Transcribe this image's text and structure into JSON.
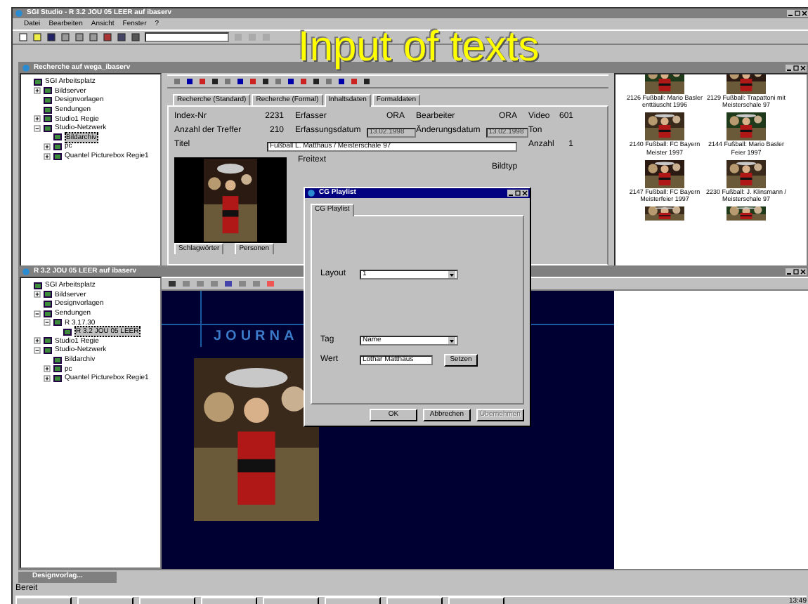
{
  "slide_title": "Input of texts",
  "app": {
    "title": "SGI Studio - R 3.2 JOU 05 LEER auf ibaserv",
    "menu": [
      "Datei",
      "Bearbeiten",
      "Ansicht",
      "Fenster",
      "?"
    ]
  },
  "search_window": {
    "title": "Recherche auf wega_ibaserv",
    "tree": [
      {
        "label": "SGI Arbeitsplatz",
        "children": [
          {
            "label": "Bildserver",
            "expanded": false,
            "selected": false
          },
          {
            "label": "Designvorlagen",
            "selected": false
          },
          {
            "label": "Sendungen",
            "selected": false
          },
          {
            "label": "Studio1 Regie",
            "expanded": false,
            "selected": false
          },
          {
            "label": "Studio-Netzwerk",
            "expanded": true,
            "selected": false,
            "children": [
              {
                "label": "Bildarchiv",
                "selected": true
              },
              {
                "label": "pc",
                "expanded": false,
                "selected": false
              },
              {
                "label": "Quantel Picturebox Regie1",
                "expanded": false,
                "selected": false
              }
            ]
          }
        ],
        "selected": false
      }
    ],
    "tabs": [
      {
        "label": "Recherche (Standard)",
        "selected": false
      },
      {
        "label": "Recherche (Formal)",
        "selected": false
      },
      {
        "label": "Inhaltsdaten",
        "selected": true
      },
      {
        "label": "Formaldaten",
        "selected": false
      }
    ],
    "field_rows": [
      [
        {
          "label": "Index-Nr",
          "value": "2231",
          "kind": "text"
        },
        {
          "label": "Erfasser",
          "value": "ORA",
          "kind": "text"
        },
        {
          "label": "Bearbeiter",
          "value": "ORA",
          "kind": "text"
        },
        {
          "label": "Video",
          "value": "601",
          "kind": "text"
        }
      ],
      [
        {
          "label": "Anzahl der Treffer",
          "value": "210",
          "kind": "text"
        },
        {
          "label": "Erfassungsdatum",
          "value": "13.02.1998",
          "kind": "date"
        },
        {
          "label": "Änderungsdatum",
          "value": "13.02.1998",
          "kind": "date"
        },
        {
          "label": "Ton",
          "kind": "label"
        }
      ],
      [
        {
          "label": "Titel",
          "value": "Fußball L. Matthäus / Meisterschale 97",
          "kind": "wide"
        },
        {
          "label": "Anzahl",
          "value": "1",
          "kind": "text"
        }
      ]
    ],
    "side_labels": [
      "Freitext",
      "Bildtyp"
    ],
    "lower_tabs": [
      "Schlagwörter",
      "Personen"
    ],
    "thumbnails": [
      {
        "caption": "2126 Fußball: Mario Basler enttäuscht 1996"
      },
      {
        "caption": "2129 Fußball: Trapattoni mit Meisterschale 97"
      },
      {
        "caption": "2140 Fußball: FC Bayern Meister 1997"
      },
      {
        "caption": "2144 Fußball: Mario Basler Feier 1997"
      },
      {
        "caption": "2147 Fußball: FC Bayern Meisterfeier 1997"
      },
      {
        "caption": "2230 Fußball: J. Klinsmann / Meisterschale 97"
      }
    ]
  },
  "layout_window": {
    "title": "R 3.2 JOU 05 LEER auf ibaserv",
    "tree": [
      {
        "label": "SGI Arbeitsplatz",
        "selected": false,
        "children": [
          {
            "label": "Bildserver",
            "expanded": false,
            "selected": false
          },
          {
            "label": "Designvorlagen",
            "selected": false
          },
          {
            "label": "Sendungen",
            "expanded": true,
            "selected": false,
            "children": [
              {
                "label": "R 3.17.30",
                "expanded": true,
                "selected": false,
                "children": [
                  {
                    "label": "R 3.2 JOU 05 LEER",
                    "selected": true
                  }
                ]
              }
            ]
          },
          {
            "label": "Studio1 Regie",
            "expanded": false,
            "selected": false
          },
          {
            "label": "Studio-Netzwerk",
            "expanded": true,
            "selected": false,
            "children": [
              {
                "label": "Bildarchiv",
                "selected": false
              },
              {
                "label": "pc",
                "expanded": false,
                "selected": false
              },
              {
                "label": "Quantel Picturebox Regie1",
                "expanded": false,
                "selected": false
              }
            ]
          }
        ]
      }
    ],
    "canvas_heading": "JOURNA"
  },
  "dialog": {
    "title": "CG Playlist",
    "tabs": [
      {
        "label": "CG Playlist",
        "selected": true
      }
    ],
    "fields": [
      {
        "label": "Layout",
        "value": "1",
        "kind": "combo"
      },
      {
        "label": "Tag",
        "value": "Name",
        "kind": "combo"
      },
      {
        "label": "Wert",
        "value": "Lothar Matthäus",
        "kind": "input"
      }
    ],
    "set_button": "Setzen",
    "buttons": [
      {
        "label": "OK",
        "disabled": false
      },
      {
        "label": "Abbrechen",
        "disabled": false
      },
      {
        "label": "Übernehmen",
        "disabled": true
      }
    ]
  },
  "minimized_window": {
    "title": "Designvorlag..."
  },
  "status_bar": {
    "text": "Bereit",
    "clock": "13:49"
  }
}
